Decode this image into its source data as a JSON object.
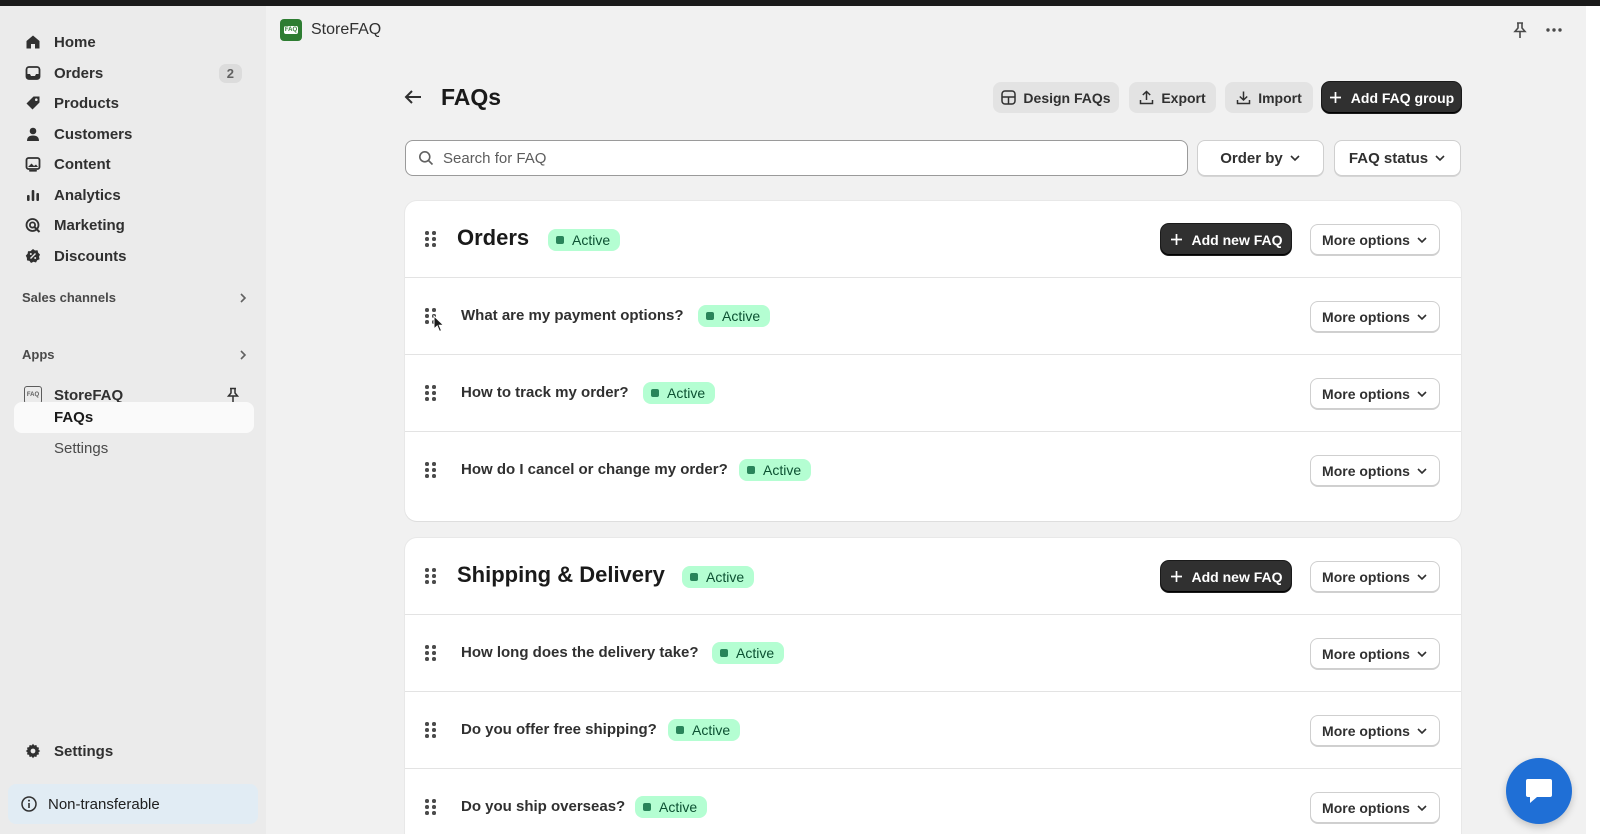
{
  "sidebar": {
    "items": [
      {
        "label": "Home",
        "icon": "home-icon"
      },
      {
        "label": "Orders",
        "icon": "inbox-icon",
        "badge": "2"
      },
      {
        "label": "Products",
        "icon": "tag-icon"
      },
      {
        "label": "Customers",
        "icon": "person-icon"
      },
      {
        "label": "Content",
        "icon": "image-icon"
      },
      {
        "label": "Analytics",
        "icon": "bar-chart-icon"
      },
      {
        "label": "Marketing",
        "icon": "target-icon"
      },
      {
        "label": "Discounts",
        "icon": "discount-icon"
      }
    ],
    "sales_channels": "Sales channels",
    "apps": "Apps",
    "app_name": "StoreFAQ",
    "app_subitems": [
      {
        "label": "FAQs",
        "active": true
      },
      {
        "label": "Settings",
        "active": false
      }
    ],
    "settings": "Settings",
    "non_transferable": "Non-transferable"
  },
  "app_header": {
    "title": "StoreFAQ",
    "logo_text": "FAQ"
  },
  "page": {
    "title": "FAQs",
    "actions": {
      "design": "Design FAQs",
      "export": "Export",
      "import": "Import",
      "add_group": "Add FAQ group"
    },
    "search_placeholder": "Search for FAQ",
    "order_by": "Order by",
    "faq_status": "FAQ status"
  },
  "groups": [
    {
      "title": "Orders",
      "status": "Active",
      "add_label": "Add new FAQ",
      "more_label": "More options",
      "faqs": [
        {
          "question": "What are my payment options?",
          "status": "Active"
        },
        {
          "question": "How to track my order?",
          "status": "Active"
        },
        {
          "question": "How do I cancel or change my order?",
          "status": "Active"
        }
      ]
    },
    {
      "title": "Shipping & Delivery",
      "status": "Active",
      "add_label": "Add new FAQ",
      "more_label": "More options",
      "faqs": [
        {
          "question": "How long does the delivery take?",
          "status": "Active"
        },
        {
          "question": "Do you offer free shipping?",
          "status": "Active"
        },
        {
          "question": "Do you ship overseas?",
          "status": "Active"
        }
      ]
    }
  ],
  "more_options": "More options",
  "colors": {
    "accent_dark": "#303030",
    "status_bg": "#b4fed2",
    "status_dot": "#29845a",
    "chat_blue": "#1f6fd6"
  }
}
